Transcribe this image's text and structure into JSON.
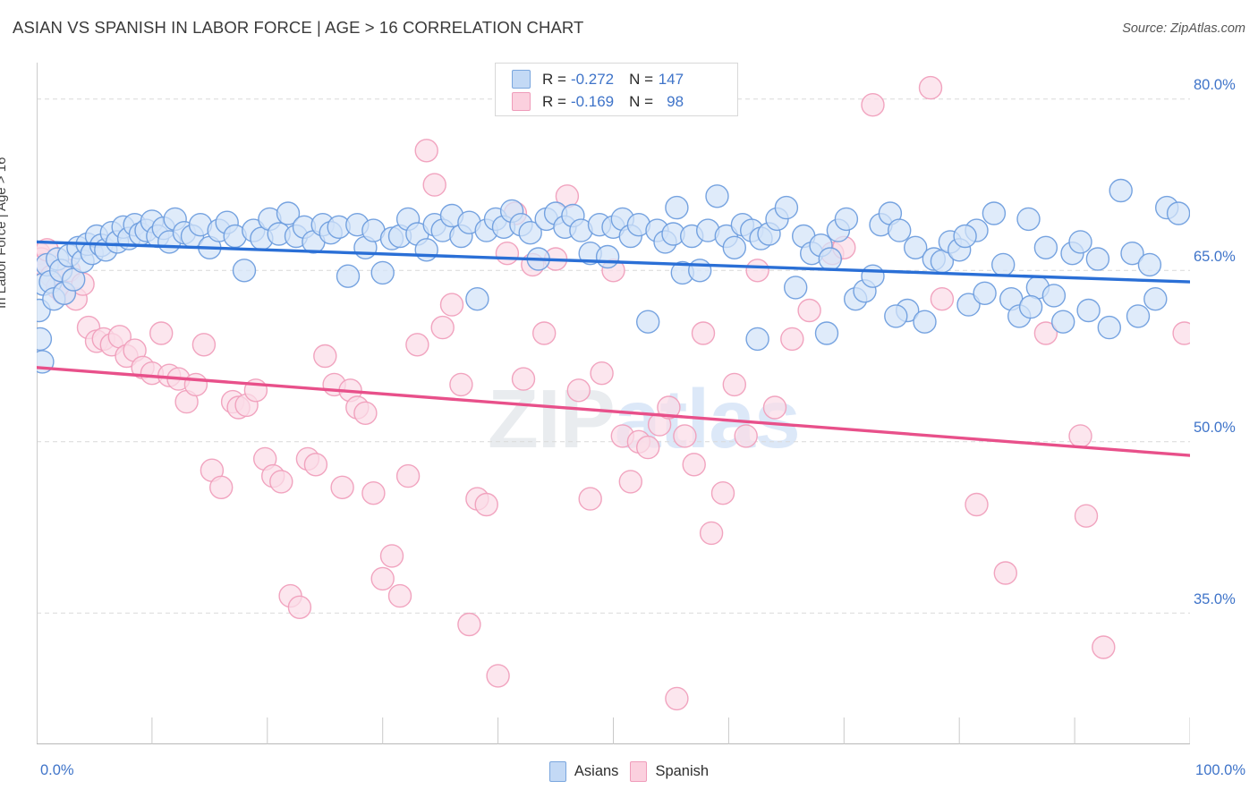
{
  "title": "ASIAN VS SPANISH IN LABOR FORCE | AGE > 16 CORRELATION CHART",
  "source": "Source: ZipAtlas.com",
  "watermark": {
    "part1": "ZIP",
    "part2": "atlas"
  },
  "stats_legend": {
    "rows": [
      {
        "series": "Asians",
        "color": "#c3d9f5",
        "r_key": "R =",
        "r_value": "-0.272",
        "n_key": "N =",
        "n_value": "147"
      },
      {
        "series": "Spanish",
        "color": "#fbd0de",
        "r_key": "R =",
        "r_value": "-0.169",
        "n_key": "N =",
        "n_value": "98"
      }
    ]
  },
  "bottom_legend": [
    {
      "label": "Asians",
      "color": "#c3d9f5",
      "border": "#7aa6de"
    },
    {
      "label": "Spanish",
      "color": "#fbd0de",
      "border": "#ef9cba"
    }
  ],
  "colors": {
    "asian_fill": "#d3e3f8",
    "asian_stroke": "#6f9ede",
    "spanish_fill": "#fbdde7",
    "spanish_stroke": "#f09fbc",
    "asian_line": "#2a6fd6",
    "spanish_line": "#e8508a",
    "axis_label": "#3f74c9",
    "grid": "#d9d9d9"
  },
  "chart_data": {
    "type": "scatter",
    "title": "ASIAN VS SPANISH IN LABOR FORCE | AGE > 16 CORRELATION CHART",
    "xlabel": "",
    "ylabel": "In Labor Force | Age > 16",
    "xlim": [
      0,
      100
    ],
    "ylim": [
      23.5,
      83.2
    ],
    "xticks": [
      "0.0%",
      "100.0%"
    ],
    "yticks": [
      "80.0%",
      "65.0%",
      "50.0%",
      "35.0%"
    ],
    "ytick_values": [
      80,
      65,
      50,
      35
    ],
    "grid": true,
    "legend_position": "bottom-center",
    "series": [
      {
        "name": "Asians",
        "color": "#d3e3f8",
        "stroke": "#6f9ede",
        "r": -0.272,
        "n": 147,
        "trendline": {
          "x0": 0,
          "y0": 67.5,
          "x1": 100,
          "y1": 64.0
        },
        "points": [
          [
            0.2,
            61.5
          ],
          [
            0.3,
            59.0
          ],
          [
            0.5,
            57.0
          ],
          [
            0.6,
            63.8
          ],
          [
            0.9,
            65.5
          ],
          [
            1.2,
            64.0
          ],
          [
            1.5,
            62.5
          ],
          [
            1.8,
            66.0
          ],
          [
            2.1,
            65.0
          ],
          [
            2.4,
            63.0
          ],
          [
            2.8,
            66.3
          ],
          [
            3.2,
            64.2
          ],
          [
            3.6,
            67.0
          ],
          [
            4.0,
            65.8
          ],
          [
            4.4,
            67.3
          ],
          [
            4.8,
            66.5
          ],
          [
            5.2,
            68.0
          ],
          [
            5.6,
            67.2
          ],
          [
            6.0,
            66.8
          ],
          [
            6.5,
            68.3
          ],
          [
            7.0,
            67.5
          ],
          [
            7.5,
            68.8
          ],
          [
            8.0,
            67.8
          ],
          [
            8.5,
            69.0
          ],
          [
            9.0,
            68.2
          ],
          [
            9.5,
            68.5
          ],
          [
            10.0,
            69.3
          ],
          [
            10.5,
            68.0
          ],
          [
            11.0,
            68.7
          ],
          [
            11.5,
            67.5
          ],
          [
            12.0,
            69.5
          ],
          [
            12.8,
            68.3
          ],
          [
            13.5,
            68.0
          ],
          [
            14.2,
            69.0
          ],
          [
            15.0,
            67.0
          ],
          [
            15.8,
            68.5
          ],
          [
            16.5,
            69.2
          ],
          [
            17.2,
            68.0
          ],
          [
            18.0,
            65.0
          ],
          [
            18.8,
            68.5
          ],
          [
            19.5,
            67.8
          ],
          [
            20.2,
            69.5
          ],
          [
            21.0,
            68.2
          ],
          [
            21.8,
            70.0
          ],
          [
            22.5,
            68.0
          ],
          [
            23.2,
            68.8
          ],
          [
            24.0,
            67.5
          ],
          [
            24.8,
            69.0
          ],
          [
            25.5,
            68.3
          ],
          [
            26.2,
            68.8
          ],
          [
            27.0,
            64.5
          ],
          [
            27.8,
            69.0
          ],
          [
            28.5,
            67.0
          ],
          [
            29.2,
            68.5
          ],
          [
            30.0,
            64.8
          ],
          [
            30.8,
            67.8
          ],
          [
            31.5,
            68.0
          ],
          [
            32.2,
            69.5
          ],
          [
            33.0,
            68.2
          ],
          [
            33.8,
            66.8
          ],
          [
            34.5,
            69.0
          ],
          [
            35.2,
            68.5
          ],
          [
            36.0,
            69.8
          ],
          [
            36.8,
            68.0
          ],
          [
            37.5,
            69.2
          ],
          [
            38.2,
            62.5
          ],
          [
            39.0,
            68.5
          ],
          [
            39.8,
            69.5
          ],
          [
            40.5,
            68.8
          ],
          [
            41.2,
            70.2
          ],
          [
            42.0,
            69.0
          ],
          [
            42.8,
            68.3
          ],
          [
            43.5,
            66.0
          ],
          [
            44.2,
            69.5
          ],
          [
            45.0,
            70.0
          ],
          [
            45.8,
            68.8
          ],
          [
            46.5,
            69.8
          ],
          [
            47.2,
            68.5
          ],
          [
            48.0,
            66.5
          ],
          [
            48.8,
            69.0
          ],
          [
            49.5,
            66.2
          ],
          [
            50.0,
            68.8
          ],
          [
            50.8,
            69.5
          ],
          [
            51.5,
            68.0
          ],
          [
            52.2,
            69.0
          ],
          [
            53.0,
            60.5
          ],
          [
            53.8,
            68.5
          ],
          [
            54.5,
            67.5
          ],
          [
            55.2,
            68.2
          ],
          [
            56.0,
            64.8
          ],
          [
            56.8,
            68.0
          ],
          [
            57.5,
            65.0
          ],
          [
            58.2,
            68.5
          ],
          [
            59.0,
            71.5
          ],
          [
            59.8,
            68.0
          ],
          [
            60.5,
            67.0
          ],
          [
            61.2,
            69.0
          ],
          [
            62.0,
            68.5
          ],
          [
            62.8,
            67.8
          ],
          [
            63.5,
            68.2
          ],
          [
            64.2,
            69.5
          ],
          [
            65.0,
            70.5
          ],
          [
            65.8,
            63.5
          ],
          [
            66.5,
            68.0
          ],
          [
            67.2,
            66.5
          ],
          [
            68.0,
            67.2
          ],
          [
            68.8,
            66.0
          ],
          [
            69.5,
            68.5
          ],
          [
            70.2,
            69.5
          ],
          [
            71.0,
            62.5
          ],
          [
            71.8,
            63.2
          ],
          [
            72.5,
            64.5
          ],
          [
            73.2,
            69.0
          ],
          [
            74.0,
            70.0
          ],
          [
            74.8,
            68.5
          ],
          [
            75.5,
            61.5
          ],
          [
            76.2,
            67.0
          ],
          [
            77.0,
            60.5
          ],
          [
            77.8,
            66.0
          ],
          [
            78.5,
            65.8
          ],
          [
            79.2,
            67.5
          ],
          [
            80.0,
            66.8
          ],
          [
            80.8,
            62.0
          ],
          [
            81.5,
            68.5
          ],
          [
            82.2,
            63.0
          ],
          [
            83.0,
            70.0
          ],
          [
            83.8,
            65.5
          ],
          [
            84.5,
            62.5
          ],
          [
            85.2,
            61.0
          ],
          [
            86.0,
            69.5
          ],
          [
            86.8,
            63.5
          ],
          [
            87.5,
            67.0
          ],
          [
            88.2,
            62.8
          ],
          [
            89.0,
            60.5
          ],
          [
            89.8,
            66.5
          ],
          [
            90.5,
            67.5
          ],
          [
            91.2,
            61.5
          ],
          [
            92.0,
            66.0
          ],
          [
            93.0,
            60.0
          ],
          [
            94.0,
            72.0
          ],
          [
            95.0,
            66.5
          ],
          [
            95.5,
            61.0
          ],
          [
            96.5,
            65.5
          ],
          [
            97.0,
            62.5
          ],
          [
            98.0,
            70.5
          ],
          [
            99.0,
            70.0
          ],
          [
            80.5,
            68.0
          ],
          [
            86.2,
            61.8
          ],
          [
            74.5,
            61.0
          ],
          [
            68.5,
            59.5
          ],
          [
            62.5,
            59.0
          ],
          [
            55.5,
            70.5
          ]
        ]
      },
      {
        "name": "Spanish",
        "color": "#fbdde7",
        "stroke": "#f09fbc",
        "r": -0.169,
        "n": 98,
        "trendline": {
          "x0": 0,
          "y0": 56.5,
          "x1": 100,
          "y1": 48.8
        },
        "points": [
          [
            0.2,
            66.5
          ],
          [
            0.4,
            66.0
          ],
          [
            0.6,
            65.5
          ],
          [
            0.9,
            66.8
          ],
          [
            1.3,
            64.5
          ],
          [
            1.8,
            63.5
          ],
          [
            2.3,
            63.0
          ],
          [
            2.8,
            65.0
          ],
          [
            3.4,
            62.5
          ],
          [
            4.0,
            63.8
          ],
          [
            4.5,
            60.0
          ],
          [
            5.2,
            58.8
          ],
          [
            5.8,
            59.0
          ],
          [
            6.5,
            58.5
          ],
          [
            7.2,
            59.2
          ],
          [
            7.8,
            57.5
          ],
          [
            8.5,
            58.0
          ],
          [
            9.2,
            56.5
          ],
          [
            10.0,
            56.0
          ],
          [
            10.8,
            59.5
          ],
          [
            11.5,
            55.8
          ],
          [
            12.3,
            55.5
          ],
          [
            13.0,
            53.5
          ],
          [
            13.8,
            55.0
          ],
          [
            14.5,
            58.5
          ],
          [
            15.2,
            47.5
          ],
          [
            16.0,
            46.0
          ],
          [
            17.0,
            53.5
          ],
          [
            17.5,
            53.0
          ],
          [
            18.2,
            53.2
          ],
          [
            19.0,
            54.5
          ],
          [
            19.8,
            48.5
          ],
          [
            20.5,
            47.0
          ],
          [
            21.2,
            46.5
          ],
          [
            22.0,
            36.5
          ],
          [
            22.8,
            35.5
          ],
          [
            23.5,
            48.5
          ],
          [
            24.2,
            48.0
          ],
          [
            25.0,
            57.5
          ],
          [
            25.8,
            55.0
          ],
          [
            26.5,
            46.0
          ],
          [
            27.2,
            54.5
          ],
          [
            27.8,
            53.0
          ],
          [
            28.5,
            52.5
          ],
          [
            29.2,
            45.5
          ],
          [
            30.0,
            38.0
          ],
          [
            30.8,
            40.0
          ],
          [
            31.5,
            36.5
          ],
          [
            32.2,
            47.0
          ],
          [
            33.0,
            58.5
          ],
          [
            33.8,
            75.5
          ],
          [
            34.5,
            72.5
          ],
          [
            35.2,
            60.0
          ],
          [
            36.0,
            62.0
          ],
          [
            36.8,
            55.0
          ],
          [
            37.5,
            34.0
          ],
          [
            38.2,
            45.0
          ],
          [
            39.0,
            44.5
          ],
          [
            40.0,
            29.5
          ],
          [
            40.8,
            66.5
          ],
          [
            41.5,
            70.0
          ],
          [
            42.2,
            55.5
          ],
          [
            43.0,
            65.5
          ],
          [
            44.0,
            59.5
          ],
          [
            45.0,
            66.0
          ],
          [
            46.0,
            71.5
          ],
          [
            47.0,
            54.5
          ],
          [
            48.0,
            45.0
          ],
          [
            49.0,
            56.0
          ],
          [
            50.0,
            65.0
          ],
          [
            50.8,
            50.5
          ],
          [
            51.5,
            46.5
          ],
          [
            52.2,
            50.0
          ],
          [
            53.0,
            49.5
          ],
          [
            54.0,
            51.5
          ],
          [
            54.8,
            53.0
          ],
          [
            55.5,
            27.5
          ],
          [
            56.2,
            50.5
          ],
          [
            57.0,
            48.0
          ],
          [
            57.8,
            59.5
          ],
          [
            58.5,
            42.0
          ],
          [
            59.5,
            45.5
          ],
          [
            60.5,
            55.0
          ],
          [
            61.5,
            50.5
          ],
          [
            62.5,
            65.0
          ],
          [
            64.0,
            53.0
          ],
          [
            65.5,
            59.0
          ],
          [
            67.0,
            61.5
          ],
          [
            69.0,
            66.5
          ],
          [
            70.0,
            67.0
          ],
          [
            72.5,
            79.5
          ],
          [
            77.5,
            81.0
          ],
          [
            78.5,
            62.5
          ],
          [
            81.5,
            44.5
          ],
          [
            84.0,
            38.5
          ],
          [
            87.5,
            59.5
          ],
          [
            90.5,
            50.5
          ],
          [
            91.0,
            43.5
          ],
          [
            92.5,
            32.0
          ],
          [
            99.5,
            59.5
          ]
        ]
      }
    ]
  },
  "axis": {
    "y_title": "In Labor Force | Age > 16",
    "x_min_label": "0.0%",
    "x_max_label": "100.0%"
  }
}
